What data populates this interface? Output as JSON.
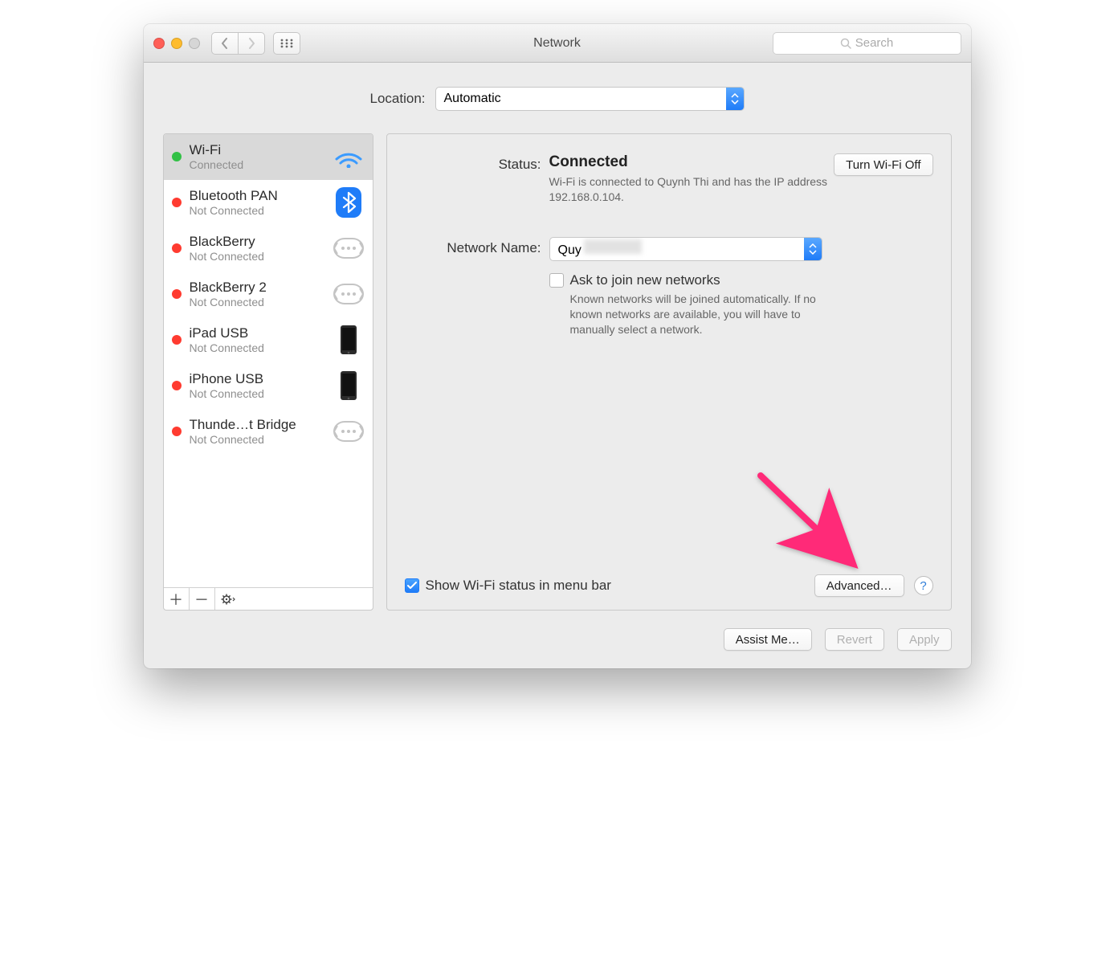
{
  "window": {
    "title": "Network",
    "search_placeholder": "Search"
  },
  "toolbar": {
    "back_icon": "chevron-left",
    "forward_icon": "chevron-right",
    "grid_icon": "apps-grid"
  },
  "location": {
    "label": "Location:",
    "value": "Automatic"
  },
  "sidebar": {
    "items": [
      {
        "name": "Wi-Fi",
        "status": "Connected",
        "status_color": "green",
        "icon": "wifi",
        "selected": true
      },
      {
        "name": "Bluetooth PAN",
        "status": "Not Connected",
        "status_color": "red",
        "icon": "bluetooth",
        "selected": false
      },
      {
        "name": "BlackBerry",
        "status": "Not Connected",
        "status_color": "red",
        "icon": "generic",
        "selected": false
      },
      {
        "name": "BlackBerry 2",
        "status": "Not Connected",
        "status_color": "red",
        "icon": "generic",
        "selected": false
      },
      {
        "name": "iPad USB",
        "status": "Not Connected",
        "status_color": "red",
        "icon": "device",
        "selected": false
      },
      {
        "name": "iPhone USB",
        "status": "Not Connected",
        "status_color": "red",
        "icon": "device",
        "selected": false
      },
      {
        "name": "Thunde…t Bridge",
        "status": "Not Connected",
        "status_color": "red",
        "icon": "generic",
        "selected": false
      }
    ],
    "footer": {
      "add": "+",
      "remove": "−",
      "settings": "gear"
    }
  },
  "details": {
    "status_label": "Status:",
    "status_value": "Connected",
    "toggle_button": "Turn Wi-Fi Off",
    "status_hint": "Wi-Fi is connected to Quynh Thi and has the IP address 192.168.0.104.",
    "network_name_label": "Network Name:",
    "network_name_value": "Quy",
    "ask_join_label": "Ask to join new networks",
    "ask_join_hint": "Known networks will be joined automatically. If no known networks are available, you will have to manually select a network.",
    "show_status_label": "Show Wi-Fi status in menu bar",
    "show_status_checked": true,
    "advanced_button": "Advanced…",
    "help": "?"
  },
  "footer": {
    "assist": "Assist Me…",
    "revert": "Revert",
    "apply": "Apply"
  }
}
